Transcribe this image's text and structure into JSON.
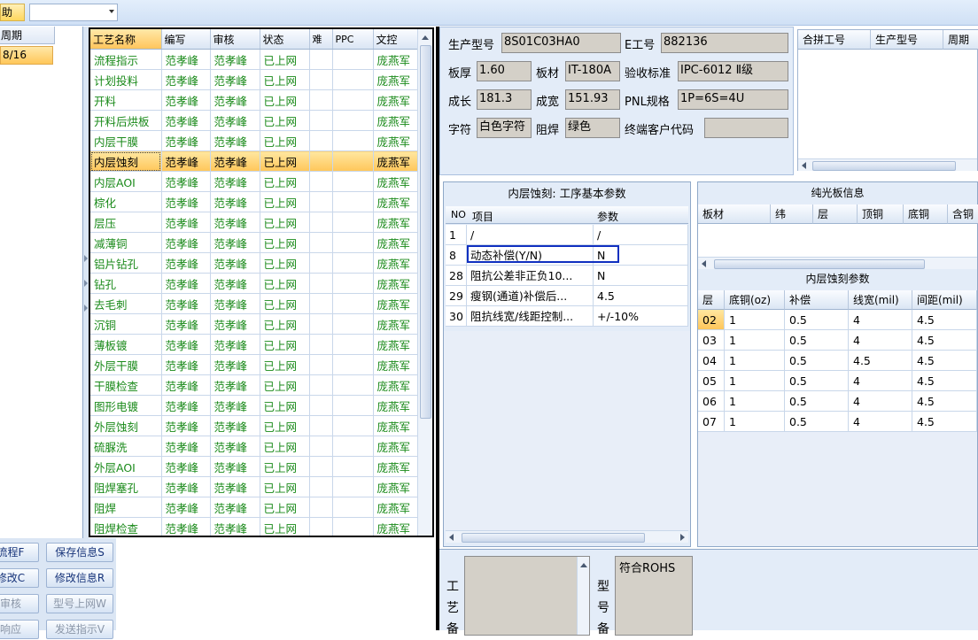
{
  "toolbar": {
    "help_label": "助",
    "combo_value": ""
  },
  "left_panel": {
    "header": "周期",
    "row_value": "8/16"
  },
  "process_grid": {
    "headers": [
      "工艺名称",
      "编写",
      "审核",
      "状态",
      "难",
      "PPC",
      "文控"
    ],
    "rows": [
      [
        "流程指示",
        "范孝峰",
        "范孝峰",
        "已上网",
        "",
        "",
        "庞燕军"
      ],
      [
        "计划投料",
        "范孝峰",
        "范孝峰",
        "已上网",
        "",
        "",
        "庞燕军"
      ],
      [
        "开料",
        "范孝峰",
        "范孝峰",
        "已上网",
        "",
        "",
        "庞燕军"
      ],
      [
        "开料后烘板",
        "范孝峰",
        "范孝峰",
        "已上网",
        "",
        "",
        "庞燕军"
      ],
      [
        "内层干膜",
        "范孝峰",
        "范孝峰",
        "已上网",
        "",
        "",
        "庞燕军"
      ],
      [
        "内层蚀刻",
        "范孝峰",
        "范孝峰",
        "已上网",
        "",
        "",
        "庞燕军"
      ],
      [
        "内层AOI",
        "范孝峰",
        "范孝峰",
        "已上网",
        "",
        "",
        "庞燕军"
      ],
      [
        "棕化",
        "范孝峰",
        "范孝峰",
        "已上网",
        "",
        "",
        "庞燕军"
      ],
      [
        "层压",
        "范孝峰",
        "范孝峰",
        "已上网",
        "",
        "",
        "庞燕军"
      ],
      [
        "减薄铜",
        "范孝峰",
        "范孝峰",
        "已上网",
        "",
        "",
        "庞燕军"
      ],
      [
        "铝片钻孔",
        "范孝峰",
        "范孝峰",
        "已上网",
        "",
        "",
        "庞燕军"
      ],
      [
        "钻孔",
        "范孝峰",
        "范孝峰",
        "已上网",
        "",
        "",
        "庞燕军"
      ],
      [
        "去毛刺",
        "范孝峰",
        "范孝峰",
        "已上网",
        "",
        "",
        "庞燕军"
      ],
      [
        "沉铜",
        "范孝峰",
        "范孝峰",
        "已上网",
        "",
        "",
        "庞燕军"
      ],
      [
        "薄板镀",
        "范孝峰",
        "范孝峰",
        "已上网",
        "",
        "",
        "庞燕军"
      ],
      [
        "外层干膜",
        "范孝峰",
        "范孝峰",
        "已上网",
        "",
        "",
        "庞燕军"
      ],
      [
        "干膜检查",
        "范孝峰",
        "范孝峰",
        "已上网",
        "",
        "",
        "庞燕军"
      ],
      [
        "图形电镀",
        "范孝峰",
        "范孝峰",
        "已上网",
        "",
        "",
        "庞燕军"
      ],
      [
        "外层蚀刻",
        "范孝峰",
        "范孝峰",
        "已上网",
        "",
        "",
        "庞燕军"
      ],
      [
        "硫脲洗",
        "范孝峰",
        "范孝峰",
        "已上网",
        "",
        "",
        "庞燕军"
      ],
      [
        "外层AOI",
        "范孝峰",
        "范孝峰",
        "已上网",
        "",
        "",
        "庞燕军"
      ],
      [
        "阻焊塞孔",
        "范孝峰",
        "范孝峰",
        "已上网",
        "",
        "",
        "庞燕军"
      ],
      [
        "阻焊",
        "范孝峰",
        "范孝峰",
        "已上网",
        "",
        "",
        "庞燕军"
      ],
      [
        "阻焊检查",
        "范孝峰",
        "范孝峰",
        "已上网",
        "",
        "",
        "庞燕军"
      ]
    ],
    "active_row": 5
  },
  "buttons": {
    "flow": "流程F",
    "save_info": "保存信息S",
    "modify": "修改C",
    "modify_info": "修改信息R",
    "audit": "审核",
    "model_online": "型号上网W",
    "response": "响应",
    "send_instruction": "发送指示V"
  },
  "info": {
    "prod_model_label": "生产型号",
    "prod_model": "8S01C03HA0",
    "e_job_label": "E工号",
    "e_job": "882136",
    "thickness_label": "板厚",
    "thickness": "1.60",
    "material_label": "板材",
    "material": "IT-180A",
    "std_label": "验收标准",
    "std": "IPC-6012 Ⅱ级",
    "length_label": "成长",
    "length": "181.3",
    "width_label": "成宽",
    "width": "151.93",
    "pnl_label": "PNL规格",
    "pnl": "1P=6S=4U",
    "char_label": "字符",
    "char": "白色字符",
    "mask_label": "阻焊",
    "mask": "绿色",
    "customer_label": "终端客户代码",
    "customer": ""
  },
  "merge_table": {
    "headers": [
      "合拼工号",
      "生产型号",
      "周期"
    ]
  },
  "basic_params": {
    "title": "内层蚀刻: 工序基本参数",
    "headers": [
      "NO",
      "项目",
      "参数"
    ],
    "rows": [
      [
        "1",
        "/",
        "/"
      ],
      [
        "8",
        "动态补偿(Y/N)",
        "N"
      ],
      [
        "28",
        "阻抗公差非正负10...",
        "N"
      ],
      [
        "29",
        "瘦钢(通道)补偿后...",
        "4.5"
      ],
      [
        "30",
        "阻抗线宽/线距控制...",
        "+/-10%"
      ]
    ]
  },
  "glossy": {
    "title": "纯光板信息",
    "headers": [
      "板材",
      "纬",
      "层",
      "顶铜",
      "底铜",
      "含铜"
    ]
  },
  "etch_params": {
    "title": "内层蚀刻参数",
    "headers": [
      "层",
      "底铜(oz)",
      "补偿",
      "线宽(mil)",
      "间距(mil)"
    ],
    "rows": [
      [
        "02",
        "1",
        "0.5",
        "4",
        "4.5"
      ],
      [
        "03",
        "1",
        "0.5",
        "4",
        "4.5"
      ],
      [
        "04",
        "1",
        "0.5",
        "4.5",
        "4.5"
      ],
      [
        "05",
        "1",
        "0.5",
        "4",
        "4.5"
      ],
      [
        "06",
        "1",
        "0.5",
        "4",
        "4.5"
      ],
      [
        "07",
        "1",
        "0.5",
        "4",
        "4.5"
      ]
    ]
  },
  "bottom": {
    "process_memo_label": [
      "工",
      "艺",
      "备"
    ],
    "model_memo_label": [
      "型",
      "号",
      "备"
    ],
    "model_memo_text": "符合ROHS"
  }
}
